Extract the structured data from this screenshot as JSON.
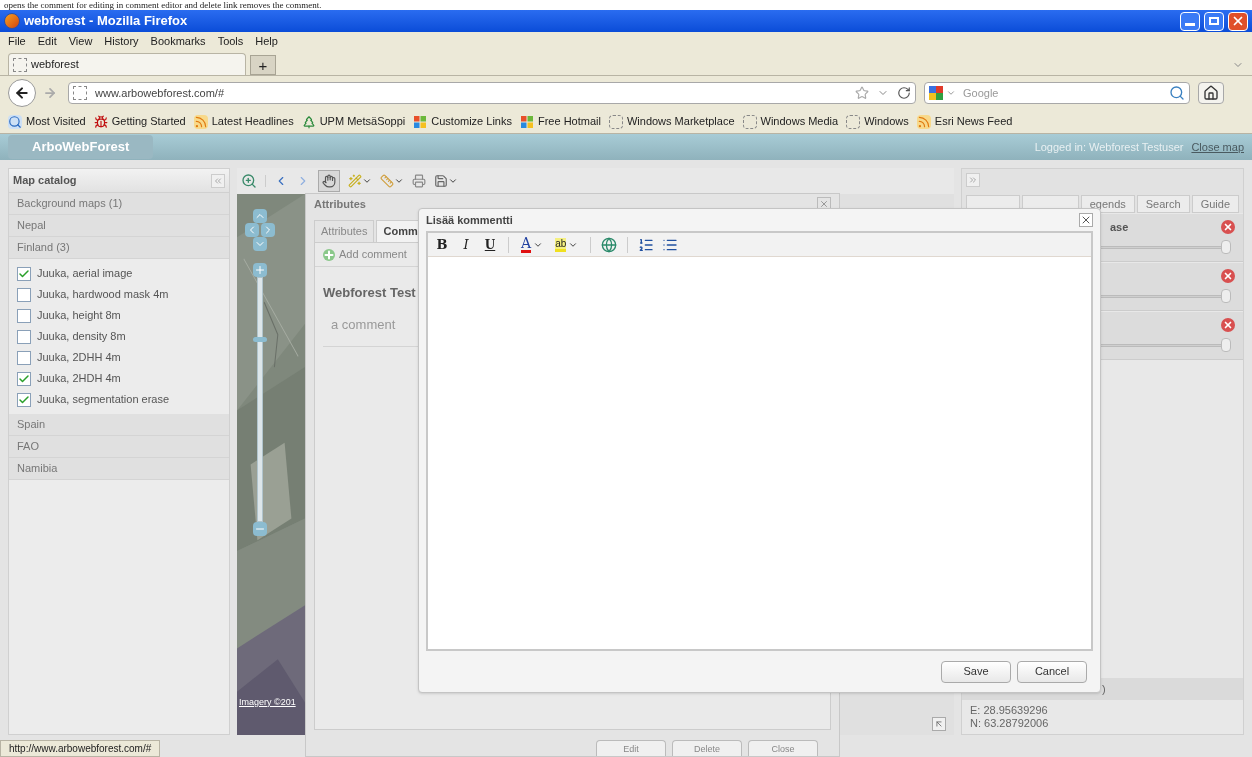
{
  "caption": "opens the comment for editing in comment editor and delete link removes the comment.",
  "browser": {
    "title": "webforest - Mozilla Firefox",
    "menu": [
      "File",
      "Edit",
      "View",
      "History",
      "Bookmarks",
      "Tools",
      "Help"
    ],
    "tab": {
      "label": "webforest",
      "new_tab": "+"
    },
    "url": "www.arbowebforest.com/#",
    "search": {
      "placeholder": "Google"
    },
    "bookmarks": [
      {
        "label": "Most Visited",
        "kind": "search"
      },
      {
        "label": "Getting Started",
        "kind": "bug"
      },
      {
        "label": "Latest Headlines",
        "kind": "rss"
      },
      {
        "label": "UPM MetsäSoppi",
        "kind": "tree"
      },
      {
        "label": "Customize Links",
        "kind": "windows"
      },
      {
        "label": "Free Hotmail",
        "kind": "windows"
      },
      {
        "label": "Windows Marketplace",
        "kind": "page"
      },
      {
        "label": "Windows Media",
        "kind": "page"
      },
      {
        "label": "Windows",
        "kind": "page"
      },
      {
        "label": "Esri News Feed",
        "kind": "rss"
      }
    ],
    "status": "http://www.arbowebforest.com/#"
  },
  "app": {
    "title": "ArboWebForest",
    "user": "Logged in: Webforest Testuser",
    "close_link": "Close map"
  },
  "catalog": {
    "title": "Map catalog",
    "groups": [
      {
        "label": "Background maps (1)"
      },
      {
        "label": "Nepal"
      },
      {
        "label": "Finland (3)",
        "layers": [
          {
            "label": "Juuka, aerial image",
            "checked": true
          },
          {
            "label": "Juuka, hardwood mask 4m",
            "checked": false
          },
          {
            "label": "Juuka, height 8m",
            "checked": false
          },
          {
            "label": "Juuka, density 8m",
            "checked": false
          },
          {
            "label": "Juuka, 2DHH 4m",
            "checked": false
          },
          {
            "label": "Juuka, 2HDH 4m",
            "checked": true
          },
          {
            "label": "Juuka, segmentation erase",
            "checked": true
          }
        ]
      },
      {
        "label": "Spain"
      },
      {
        "label": "FAO"
      },
      {
        "label": "Namibia"
      }
    ]
  },
  "map": {
    "attribution": "Imagery ©201",
    "zoom": {
      "level": 0.75
    }
  },
  "attributes_window": {
    "title": "Attributes",
    "tabs": [
      {
        "label": "Attributes",
        "selected": false
      },
      {
        "label": "Comm",
        "selected": true
      }
    ],
    "add_comment": "Add comment",
    "comments": [
      {
        "author": "Webforest Test",
        "text": "a comment"
      }
    ],
    "buttons": [
      "Edit",
      "Delete",
      "Close"
    ]
  },
  "comment_dialog": {
    "title": "Lisää kommentti",
    "toolbar": [
      {
        "kind": "bold",
        "label": "B"
      },
      {
        "kind": "italic",
        "label": "I"
      },
      {
        "kind": "underline",
        "label": "U"
      },
      {
        "kind": "separator"
      },
      {
        "kind": "font-color",
        "label": "A"
      },
      {
        "kind": "highlight",
        "label": "ab"
      },
      {
        "kind": "separator"
      },
      {
        "kind": "link"
      },
      {
        "kind": "separator"
      },
      {
        "kind": "ordered-list"
      },
      {
        "kind": "bullet-list"
      }
    ],
    "buttons": [
      "Save",
      "Cancel"
    ]
  },
  "right_panel": {
    "tabs": [
      {
        "label": "egends"
      },
      {
        "label": "Search"
      },
      {
        "label": "Guide"
      }
    ],
    "layers": [
      {
        "title": "ase",
        "level": 1
      },
      {
        "level": 1
      },
      {
        "level": 1
      }
    ],
    "coords": {
      "header": ")",
      "east": "E: 28.95639296",
      "north": "N: 63.28792006"
    }
  }
}
